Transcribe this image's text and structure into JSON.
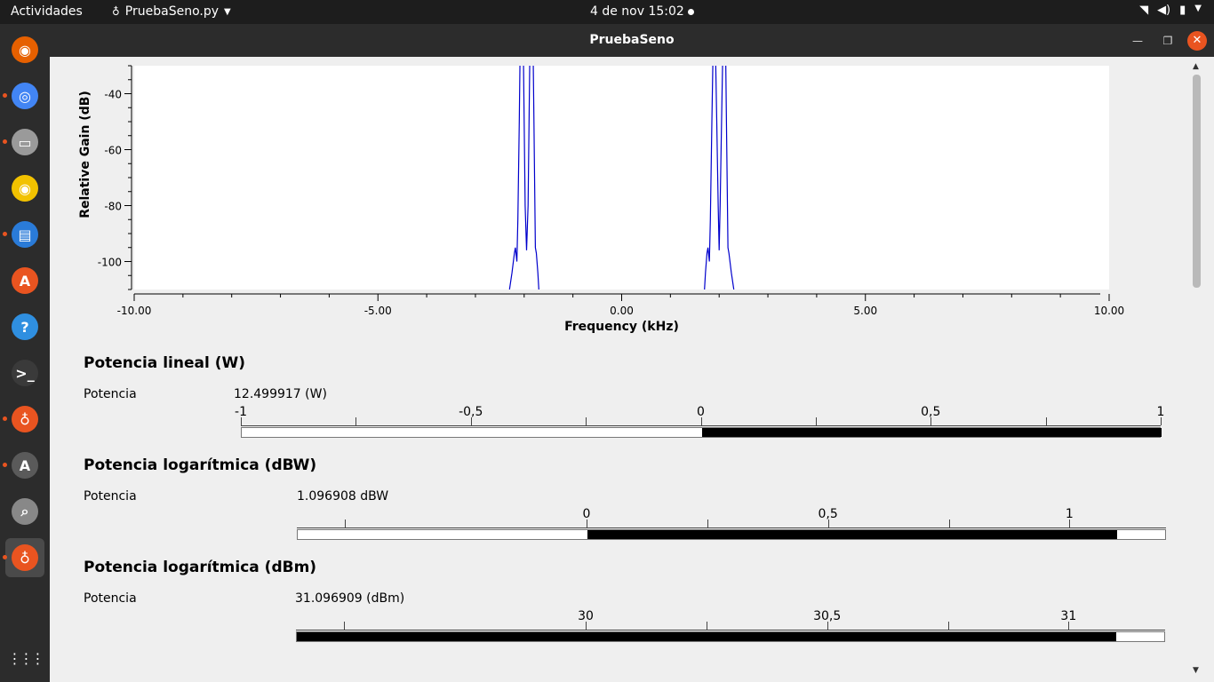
{
  "topbar": {
    "activities": "Actividades",
    "app_name": "PruebaSeno.py",
    "clock": "4 de nov  15:02"
  },
  "dock": {
    "items": [
      {
        "icon": "firefox-icon",
        "color": "#e66000",
        "running": false
      },
      {
        "icon": "chrome-icon",
        "color": "#4285f4",
        "running": true
      },
      {
        "icon": "files-icon",
        "color": "#9a9a9a",
        "running": true
      },
      {
        "icon": "rhythmbox-icon",
        "color": "#f2c200",
        "running": false
      },
      {
        "icon": "writer-icon",
        "color": "#2a7bd8",
        "running": true
      },
      {
        "icon": "software-icon",
        "color": "#e95420",
        "running": false
      },
      {
        "icon": "help-icon",
        "color": "#2f8fe0",
        "running": false
      },
      {
        "icon": "terminal-icon",
        "color": "#3a3a3a",
        "running": false
      },
      {
        "icon": "gnuradio-icon",
        "color": "#e95420",
        "running": true
      },
      {
        "icon": "updater-icon",
        "color": "#5a5a5a",
        "running": true
      },
      {
        "icon": "image-viewer-icon",
        "color": "#888888",
        "running": false
      },
      {
        "icon": "gnuradio-icon",
        "color": "#e95420",
        "running": true,
        "active": true
      }
    ],
    "apps_grid_icon": "apps-grid-icon"
  },
  "window": {
    "title": "PruebaSeno"
  },
  "chart_data": {
    "type": "line",
    "xlabel": "Frequency (kHz)",
    "ylabel": "Relative Gain (dB)",
    "xlim": [
      -10,
      10
    ],
    "ylim": [
      -110,
      -30
    ],
    "xticks": [
      "-10.00",
      "-5.00",
      "0.00",
      "5.00",
      "10.00"
    ],
    "yticks": [
      "-40",
      "-60",
      "-80",
      "-100"
    ],
    "series": [
      {
        "color": "#0000cc",
        "x": [
          -2.3,
          -2.25,
          -2.2,
          -2.18,
          -2.15,
          -2.13,
          -2.1,
          -2.08,
          -2.05,
          -2.02,
          -2.0,
          -1.98,
          -1.95,
          -1.92,
          -1.9,
          -1.88,
          -1.85,
          -1.82,
          -1.8,
          -1.77,
          -1.75,
          -1.72,
          -1.7
        ],
        "y": [
          -110,
          -104,
          -97,
          -95,
          -100,
          -85,
          -50,
          -20,
          0,
          -20,
          -50,
          -80,
          -96,
          -80,
          -50,
          -20,
          0,
          -20,
          -50,
          -95,
          -97,
          -104,
          -110
        ]
      },
      {
        "color": "#0000cc",
        "x": [
          1.7,
          1.72,
          1.75,
          1.77,
          1.8,
          1.82,
          1.85,
          1.88,
          1.9,
          1.92,
          1.95,
          1.98,
          2.0,
          2.02,
          2.05,
          2.08,
          2.1,
          2.13,
          2.15,
          2.18,
          2.2,
          2.25,
          2.3
        ],
        "y": [
          -110,
          -104,
          -97,
          -95,
          -100,
          -85,
          -50,
          -20,
          0,
          -20,
          -50,
          -80,
          -96,
          -80,
          -50,
          -20,
          0,
          -20,
          -50,
          -95,
          -97,
          -104,
          -110
        ]
      }
    ]
  },
  "sections": [
    {
      "title": "Potencia lineal (W)",
      "label": "Potencia",
      "value": "12.499917 (W)",
      "min": -1,
      "max": 1,
      "ticks": [
        {
          "v": -1,
          "label": "-1"
        },
        {
          "v": -0.75,
          "label": ""
        },
        {
          "v": -0.5,
          "label": "-0,5"
        },
        {
          "v": -0.25,
          "label": ""
        },
        {
          "v": 0,
          "label": "0"
        },
        {
          "v": 0.25,
          "label": ""
        },
        {
          "v": 0.5,
          "label": "0,5"
        },
        {
          "v": 0.75,
          "label": ""
        },
        {
          "v": 1,
          "label": "1"
        }
      ],
      "fill_from": 0,
      "fill_to": 1
    },
    {
      "title": "Potencia logarítmica (dBW)",
      "label": "Potencia",
      "value": "1.096908 dBW",
      "min": -0.6,
      "max": 1.2,
      "ticks": [
        {
          "v": -0.5,
          "label": ""
        },
        {
          "v": 0,
          "label": "0"
        },
        {
          "v": 0.25,
          "label": ""
        },
        {
          "v": 0.5,
          "label": "0,5"
        },
        {
          "v": 0.75,
          "label": ""
        },
        {
          "v": 1,
          "label": "1"
        }
      ],
      "fill_from": 0,
      "fill_to": 1.097
    },
    {
      "title": "Potencia logarítmica (dBm)",
      "label": "Potencia",
      "value": "31.096909 (dBm)",
      "min": 29.4,
      "max": 31.2,
      "ticks": [
        {
          "v": 29.5,
          "label": ""
        },
        {
          "v": 30,
          "label": "30"
        },
        {
          "v": 30.25,
          "label": ""
        },
        {
          "v": 30.5,
          "label": "30,5"
        },
        {
          "v": 30.75,
          "label": ""
        },
        {
          "v": 31,
          "label": "31"
        }
      ],
      "fill_from": 29.4,
      "fill_to": 31.097
    }
  ]
}
